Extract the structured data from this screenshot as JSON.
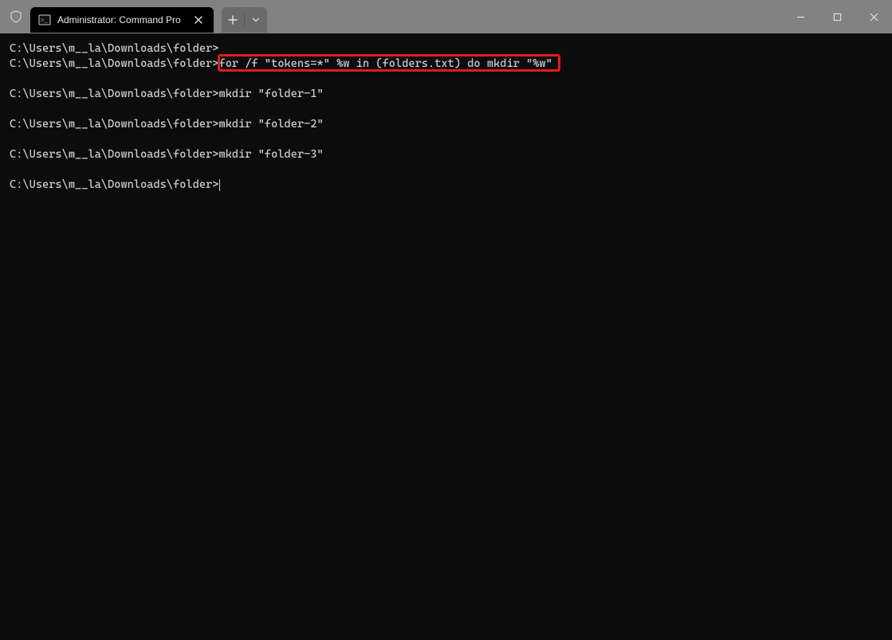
{
  "window": {
    "tab_title": "Administrator: Command Pro",
    "icons": {
      "shield": "shield-icon",
      "cmd": "cmd-icon",
      "close_tab": "close-icon",
      "new_tab_plus": "plus-icon",
      "new_tab_dropdown": "chevron-down-icon",
      "minimize": "minimize-icon",
      "maximize": "maximize-icon",
      "close": "close-icon"
    }
  },
  "terminal": {
    "prompt": "C:\\Users\\m__la\\Downloads\\folder>",
    "lines": [
      {
        "prompt": "C:\\Users\\m__la\\Downloads\\folder>",
        "cmd": ""
      },
      {
        "prompt": "C:\\Users\\m__la\\Downloads\\folder>",
        "cmd": "for /f \"tokens=*\" %w in (folders.txt) do mkdir \"%w\"",
        "highlight": true
      },
      {
        "blank": true
      },
      {
        "prompt": "C:\\Users\\m__la\\Downloads\\folder>",
        "cmd": "mkdir \"folder-1\""
      },
      {
        "blank": true
      },
      {
        "prompt": "C:\\Users\\m__la\\Downloads\\folder>",
        "cmd": "mkdir \"folder-2\""
      },
      {
        "blank": true
      },
      {
        "prompt": "C:\\Users\\m__la\\Downloads\\folder>",
        "cmd": "mkdir \"folder-3\""
      },
      {
        "blank": true
      },
      {
        "prompt": "C:\\Users\\m__la\\Downloads\\folder>",
        "cmd": "",
        "cursor": true
      }
    ]
  }
}
